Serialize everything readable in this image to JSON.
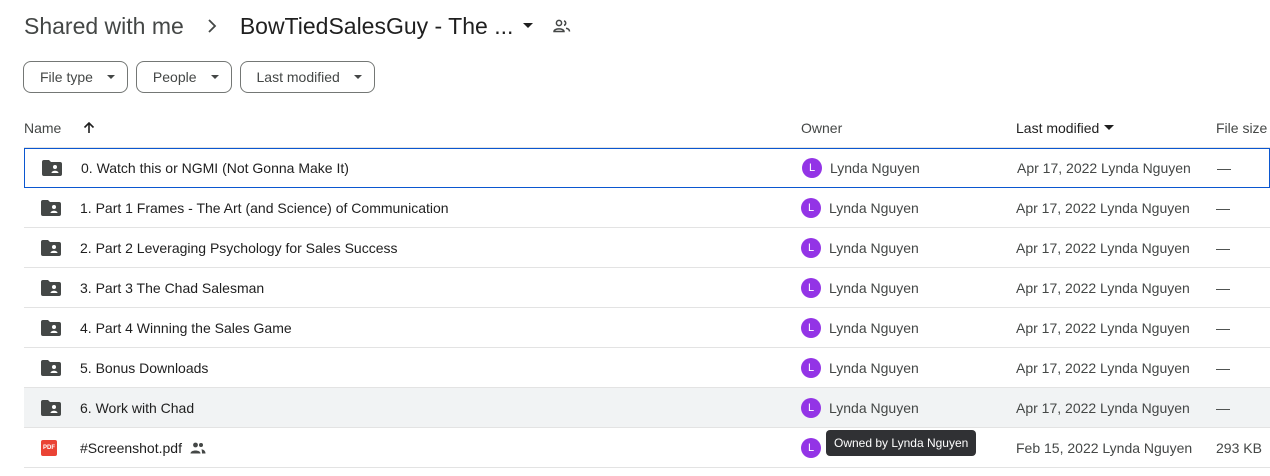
{
  "breadcrumb": {
    "root": "Shared with me",
    "current": "BowTiedSalesGuy - The ..."
  },
  "filters": [
    {
      "label": "File type"
    },
    {
      "label": "People"
    },
    {
      "label": "Last modified"
    }
  ],
  "columns": {
    "name": "Name",
    "owner": "Owner",
    "modified": "Last modified",
    "size": "File size"
  },
  "rows": [
    {
      "name": "0. Watch this or NGMI (Not Gonna Make It)",
      "type": "folder",
      "avatar": "L",
      "owner": "Lynda Nguyen",
      "modified": "Apr 17, 2022 Lynda Nguyen",
      "size": "—"
    },
    {
      "name": "1. Part 1 Frames - The Art (and Science) of Communication",
      "type": "folder",
      "avatar": "L",
      "owner": "Lynda Nguyen",
      "modified": "Apr 17, 2022 Lynda Nguyen",
      "size": "—"
    },
    {
      "name": "2. Part 2 Leveraging Psychology for Sales Success",
      "type": "folder",
      "avatar": "L",
      "owner": "Lynda Nguyen",
      "modified": "Apr 17, 2022 Lynda Nguyen",
      "size": "—"
    },
    {
      "name": "3. Part 3 The Chad Salesman",
      "type": "folder",
      "avatar": "L",
      "owner": "Lynda Nguyen",
      "modified": "Apr 17, 2022 Lynda Nguyen",
      "size": "—"
    },
    {
      "name": "4. Part 4 Winning the Sales Game",
      "type": "folder",
      "avatar": "L",
      "owner": "Lynda Nguyen",
      "modified": "Apr 17, 2022 Lynda Nguyen",
      "size": "—"
    },
    {
      "name": "5. Bonus Downloads",
      "type": "folder",
      "avatar": "L",
      "owner": "Lynda Nguyen",
      "modified": "Apr 17, 2022 Lynda Nguyen",
      "size": "—"
    },
    {
      "name": "6. Work with Chad",
      "type": "folder",
      "avatar": "L",
      "owner": "Lynda Nguyen",
      "modified": "Apr 17, 2022 Lynda Nguyen",
      "size": "—"
    },
    {
      "name": "#Screenshot.pdf",
      "type": "pdf",
      "pdf_badge": "PDF",
      "avatar": "L",
      "owner": "",
      "modified": "Feb 15, 2022 Lynda Nguyen",
      "size": "293 KB"
    }
  ],
  "tooltip": "Owned by Lynda Nguyen",
  "colors": {
    "accent": "#0b57d0",
    "avatar": "#9334e6",
    "pdf": "#ea4335"
  },
  "icons": {
    "folder": "shared-folder-icon",
    "pdf": "pdf-file-icon",
    "shared": "people-icon",
    "sort": "arrow-up-icon"
  }
}
